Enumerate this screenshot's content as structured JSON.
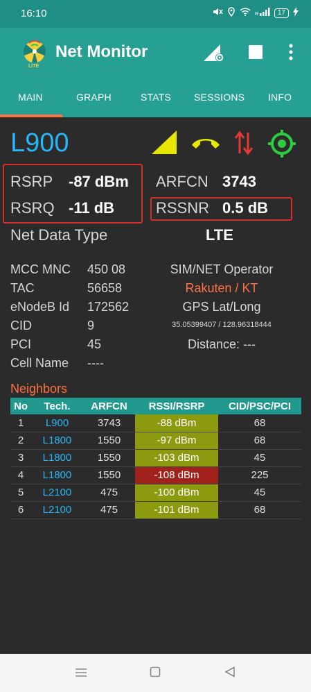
{
  "status": {
    "time": "16:10",
    "battery": "17"
  },
  "app": {
    "title": "Net Monitor",
    "logo_text": "LITE"
  },
  "tabs": [
    {
      "label": "MAIN",
      "active": true
    },
    {
      "label": "GRAPH"
    },
    {
      "label": "STATS"
    },
    {
      "label": "SESSIONS"
    },
    {
      "label": "INFO"
    }
  ],
  "cell": {
    "band": "L900",
    "rsrp_label": "RSRP",
    "rsrp_value": "-87 dBm",
    "rsrq_label": "RSRQ",
    "rsrq_value": "-11 dB",
    "arfcn_label": "ARFCN",
    "arfcn_value": "3743",
    "rssnr_label": "RSSNR",
    "rssnr_value": "0.5 dB",
    "net_data_type_label": "Net Data Type",
    "net_data_type_value": "LTE"
  },
  "info": {
    "mcc_mnc_label": "MCC MNC",
    "mcc_mnc_value": "450 08",
    "tac_label": "TAC",
    "tac_value": "56658",
    "enodeb_label": "eNodeB Id",
    "enodeb_value": "172562",
    "cid_label": "CID",
    "cid_value": "9",
    "pci_label": "PCI",
    "pci_value": "45",
    "cellname_label": "Cell Name",
    "cellname_value": "----",
    "operator_label": "SIM/NET Operator",
    "operator_value": "Rakuten / KT",
    "gps_label": "GPS Lat/Long",
    "gps_value": "35.05399407 / 128.96318444",
    "distance_label": "Distance: ---"
  },
  "neighbors": {
    "title": "Neighbors",
    "headers": [
      "No",
      "Tech.",
      "ARFCN",
      "RSSI/RSRP",
      "CID/PSC/PCI"
    ],
    "rows": [
      {
        "no": "1",
        "tech": "L900",
        "arfcn": "3743",
        "rssi": "-88 dBm",
        "cid": "68",
        "color": "#8c9a10"
      },
      {
        "no": "2",
        "tech": "L1800",
        "arfcn": "1550",
        "rssi": "-97 dBm",
        "cid": "68",
        "color": "#8c9a10"
      },
      {
        "no": "3",
        "tech": "L1800",
        "arfcn": "1550",
        "rssi": "-103 dBm",
        "cid": "45",
        "color": "#8c9a10"
      },
      {
        "no": "4",
        "tech": "L1800",
        "arfcn": "1550",
        "rssi": "-108 dBm",
        "cid": "225",
        "color": "#a1221a"
      },
      {
        "no": "5",
        "tech": "L2100",
        "arfcn": "475",
        "rssi": "-100 dBm",
        "cid": "45",
        "color": "#8c9a10"
      },
      {
        "no": "6",
        "tech": "L2100",
        "arfcn": "475",
        "rssi": "-101 dBm",
        "cid": "68",
        "color": "#8c9a10"
      }
    ]
  },
  "colors": {
    "accent": "#27a094",
    "band": "#29b6f6",
    "operator": "#ff7043",
    "signal": "#e6e600",
    "locate": "#2ecc40"
  }
}
